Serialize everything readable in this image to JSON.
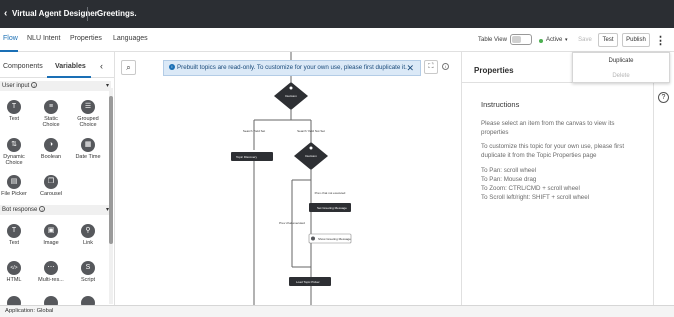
{
  "topbar": {
    "back_icon": "chevron-left-icon",
    "back_glyph": "‹",
    "app_title": "Virtual Agent Designer",
    "topic_name": "Greetings."
  },
  "tabs": [
    "Flow",
    "NLU Intent",
    "Properties",
    "Languages"
  ],
  "toolbar": {
    "table_view_label": "Table View",
    "status_label": "Active",
    "status_caret": "▾",
    "status_color": "#4caf50",
    "save_label": "Save",
    "test_label": "Test",
    "publish_label": "Publish",
    "more_glyph": "⋮"
  },
  "more_menu": {
    "duplicate": "Duplicate",
    "delete": "Delete"
  },
  "left_panel": {
    "tab_components": "Components",
    "tab_variables": "Variables",
    "collapse_glyph": "‹",
    "user_input_title": "User input",
    "bot_response_title": "Bot response",
    "info_glyph": "i",
    "section_caret": "▾",
    "user_input": [
      {
        "label": "Text",
        "glyph": "T"
      },
      {
        "label": "Static Choice",
        "glyph": "≡"
      },
      {
        "label": "Grouped Choice",
        "glyph": "☰"
      },
      {
        "label": "Dynamic Choice",
        "glyph": "⇅"
      },
      {
        "label": "Boolean",
        "glyph": "◑"
      },
      {
        "label": "Date Time",
        "glyph": "▦"
      },
      {
        "label": "File Picker",
        "glyph": "▤"
      },
      {
        "label": "Carousel",
        "glyph": "❐"
      }
    ],
    "bot_response": [
      {
        "label": "Text",
        "glyph": "T"
      },
      {
        "label": "Image",
        "glyph": "▣"
      },
      {
        "label": "Link",
        "glyph": "⚲"
      },
      {
        "label": "HTML",
        "glyph": "</>"
      },
      {
        "label": "Multi-res...",
        "glyph": "⋯"
      },
      {
        "label": "Script",
        "glyph": "S"
      }
    ]
  },
  "canvas": {
    "search_glyph": "⌕",
    "banner_text": "Prebuilt topics are read-only. To customize for your own use, please first duplicate it.",
    "banner_info_glyph": "i",
    "banner_close_glyph": "✕",
    "fit_glyph": "⛶",
    "info_glyph": "i",
    "flow": {
      "decision1": "Decision",
      "branch_left": "Search Yield Set",
      "branch_right": "Search Yield Not Set",
      "topic_discovery": "Topic Discovery",
      "decision2": "Decision",
      "cond_not_executed": "Prev chat not executed",
      "cond_executed": "Prev chat executed",
      "set_greeting": "Set Greeting Message",
      "show_greeting": "Show Greeting Message",
      "topic_picker": "Load Topic Picker"
    }
  },
  "properties": {
    "title": "Properties",
    "instructions_title": "Instructions",
    "p1": "Please select an item from the canvas to view its properties",
    "p2": "To customize this topic for your own use, please first duplicate it from the Topic Properties page",
    "l1": "To Pan: scroll wheel",
    "l2": "To Pan: Mouse drag",
    "l3": "To Zoom: CTRL/CMD + scroll wheel",
    "l4": "To Scroll left/right: SHIFT + scroll wheel",
    "help_glyph": "?"
  },
  "footer": {
    "application": "Application: Global"
  }
}
